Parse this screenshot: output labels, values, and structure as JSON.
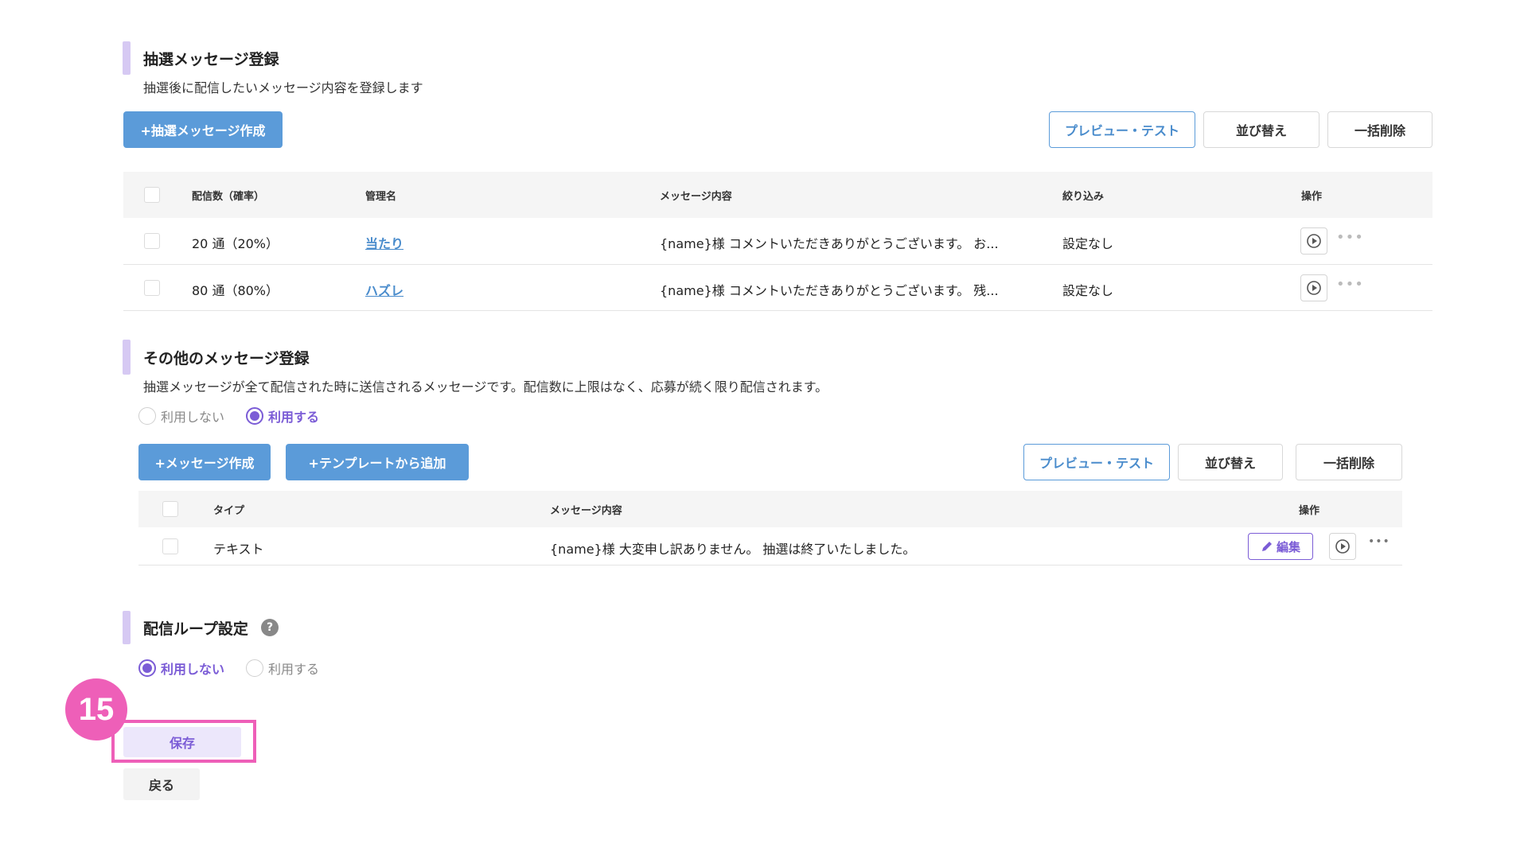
{
  "lottery_section": {
    "title": "抽選メッセージ登録",
    "description": "抽選後に配信したいメッセージ内容を登録します",
    "create_button": "+抽選メッセージ作成",
    "preview_button": "プレビュー・テスト",
    "sort_button": "並び替え",
    "bulk_delete_button": "一括削除",
    "columns": [
      "配信数（確率）",
      "管理名",
      "メッセージ内容",
      "絞り込み",
      "操作"
    ],
    "rows": [
      {
        "count": "20 通（20%）",
        "name": "当たり",
        "content": "{name}様 コメントいただきありがとうございます。 お...",
        "filter": "設定なし"
      },
      {
        "count": "80 通（80%）",
        "name": "ハズレ",
        "content": "{name}様 コメントいただきありがとうございます。 残...",
        "filter": "設定なし"
      }
    ]
  },
  "other_section": {
    "title": "その他のメッセージ登録",
    "description": "抽選メッセージが全て配信された時に送信されるメッセージです。配信数に上限はなく、応募が続く限り配信されます。",
    "radio_off_label": "利用しない",
    "radio_on_label": "利用する",
    "selected": "利用する",
    "create_button": "+メッセージ作成",
    "template_button": "+テンプレートから追加",
    "preview_button": "プレビュー・テスト",
    "sort_button": "並び替え",
    "bulk_delete_button": "一括削除",
    "columns": [
      "タイプ",
      "メッセージ内容",
      "操作"
    ],
    "rows": [
      {
        "type": "テキスト",
        "content": "{name}様 大変申し訳ありません。 抽選は終了いたしました。",
        "edit": "編集"
      }
    ]
  },
  "loop_section": {
    "title": "配信ループ設定",
    "help": "?",
    "radio_off_label": "利用しない",
    "radio_on_label": "利用する",
    "selected": "利用しない"
  },
  "step_badge": "15",
  "save_button": "保存",
  "back_button": "戻る",
  "colors": {
    "accent_purple": "#7b5cd6",
    "primary_blue": "#5b9bd9",
    "highlight_pink": "#ee5fb8",
    "section_bar": "#d6c9f3"
  }
}
